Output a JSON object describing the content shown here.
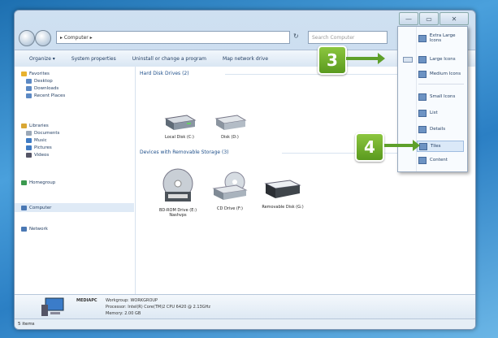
{
  "window": {
    "controls": [
      "—",
      "▭",
      "✕"
    ]
  },
  "address": {
    "path": "▸ Computer ▸",
    "search_placeholder": "Search Computer",
    "refresh": "↻"
  },
  "toolbar": {
    "items": [
      "Organize ▾",
      "System properties",
      "Uninstall or change a program",
      "Map network drive"
    ]
  },
  "sidebar": {
    "items": [
      {
        "label": "Favorites",
        "color": "#e8b230"
      },
      {
        "label": "Desktop",
        "color": "#5c89c4"
      },
      {
        "label": "Downloads",
        "color": "#5c89c4"
      },
      {
        "label": "Recent Places",
        "color": "#5c89c4"
      },
      {
        "label": "Libraries",
        "color": "#d9a734"
      },
      {
        "label": "Documents",
        "color": "#9aa8b8"
      },
      {
        "label": "Music",
        "color": "#3f7bc4"
      },
      {
        "label": "Pictures",
        "color": "#3f7bc4"
      },
      {
        "label": "Videos",
        "color": "#556"
      },
      {
        "label": "Homegroup",
        "color": "#3c9a4f"
      },
      {
        "label": "Computer",
        "color": "#4a78b4"
      },
      {
        "label": "Network",
        "color": "#4a78b4"
      }
    ]
  },
  "groups": [
    {
      "label": "Hard Disk Drives (2)"
    },
    {
      "label": "Devices with Removable Storage (3)"
    }
  ],
  "drives": [
    {
      "label": "Local Disk (C:)"
    },
    {
      "label": "Disk (D:)"
    },
    {
      "label": "BD-ROM Drive (E:) Nashvps"
    },
    {
      "label": "CD Drive (F:)"
    },
    {
      "label": "Removable Disk (G:)"
    }
  ],
  "details": {
    "name": "MEDIAPC",
    "workgroup": "Workgroup: WORKGROUP",
    "processor": "Processor: Intel(R) Core(TM)2 CPU    6420 @ 2.13GHz",
    "memory": "Memory: 2.00 GB"
  },
  "status": {
    "text": "5 items"
  },
  "view_menu": {
    "items": [
      "Extra Large Icons",
      "Large Icons",
      "Medium Icons",
      "Small Icons",
      "List",
      "Details",
      "Tiles",
      "Content"
    ],
    "selected": "Tiles"
  },
  "callouts": [
    {
      "number": "3",
      "color": "#6aae2a"
    },
    {
      "number": "4",
      "color": "#6aae2a"
    }
  ]
}
